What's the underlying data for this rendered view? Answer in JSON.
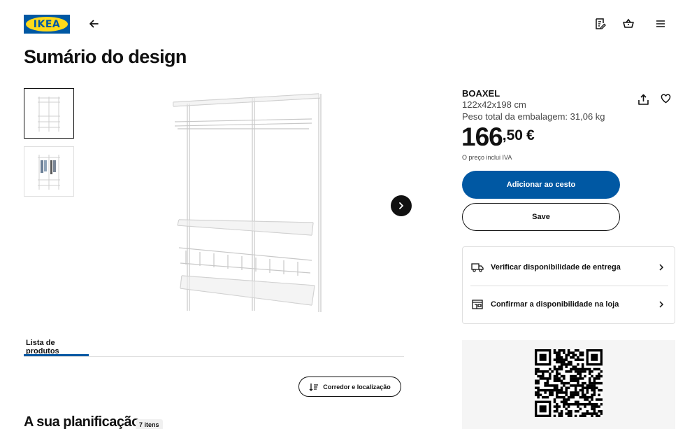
{
  "header": {
    "logo_text": "IKEA",
    "icons": [
      "arrow-left-icon",
      "shopping-list-icon",
      "shopping-bag-icon",
      "menu-icon"
    ]
  },
  "page": {
    "title": "Sumário do design"
  },
  "gallery": {
    "thumbnails": [
      "thumbnail-shelving",
      "thumbnail-shelving-with-clothes"
    ],
    "selected_index": 0
  },
  "product": {
    "name": "BOAXEL",
    "dimensions": "122x42x198 cm",
    "weight": "Peso total da embalagem: 31,06 kg",
    "price_integer": "166",
    "price_decimal": ",50",
    "currency": "€",
    "vat_note": "O preço inclui IVA",
    "add_to_cart_label": "Adicionar ao cesto",
    "save_label": "Save"
  },
  "availability": {
    "delivery_label": "Verificar disponibilidade de entrega",
    "store_label": "Confirmar a disponibilidade na loja"
  },
  "tabs": {
    "product_list_label": "Lista de produtos"
  },
  "sort": {
    "label": "Corredor e localização"
  },
  "plan": {
    "title": "A sua planificação",
    "count": "7 itens"
  },
  "colors": {
    "brand_blue": "#0058a3",
    "brand_yellow": "#ffda1a",
    "text": "#111111"
  }
}
